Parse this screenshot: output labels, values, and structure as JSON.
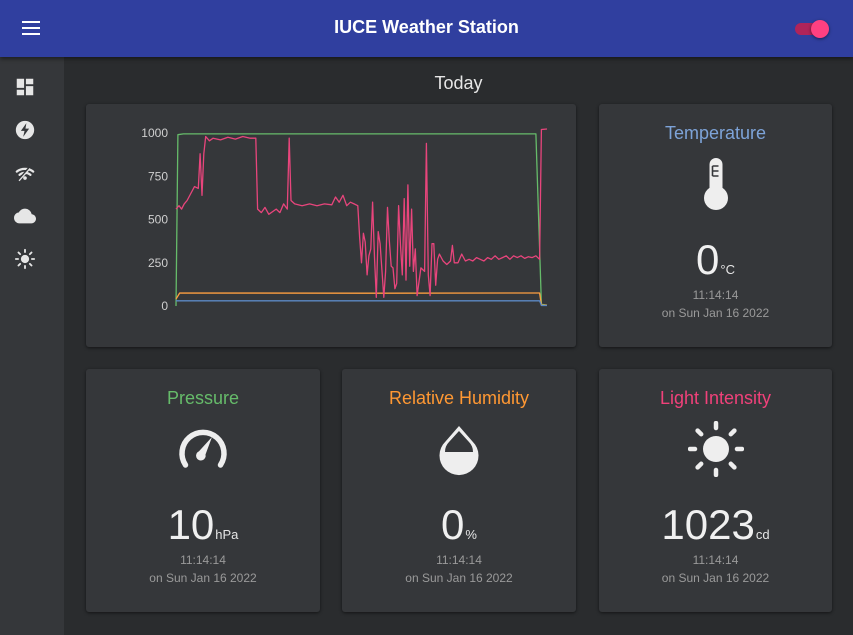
{
  "app": {
    "title": "IUCE Weather Station",
    "accent_color": "#303f9f",
    "toggle_on": true,
    "toggle_color": "#ff4081"
  },
  "sidebar": {
    "items": [
      {
        "icon": "dashboard-icon"
      },
      {
        "icon": "bolt-icon"
      },
      {
        "icon": "wifi-icon"
      },
      {
        "icon": "cloud-icon"
      },
      {
        "icon": "sun-icon"
      }
    ]
  },
  "page": {
    "title": "Today"
  },
  "chart_data": {
    "type": "line",
    "title": "",
    "xlabel": "",
    "ylabel": "",
    "ylim": [
      0,
      1000
    ],
    "yticks": [
      "1000",
      "750",
      "500",
      "250",
      "0"
    ],
    "grid": false,
    "legend": "none",
    "series": [
      {
        "color": "#66bb6a",
        "values": [
          [
            0,
            0
          ],
          [
            0.5,
            990
          ],
          [
            2,
            995
          ],
          [
            50,
            995
          ],
          [
            97,
            995
          ],
          [
            98.5,
            10
          ],
          [
            100,
            5
          ]
        ]
      },
      {
        "color": "#ff9f40",
        "values": [
          [
            0,
            40
          ],
          [
            1,
            75
          ],
          [
            50,
            74
          ],
          [
            98,
            75
          ],
          [
            98.5,
            5
          ],
          [
            100,
            5
          ]
        ]
      },
      {
        "color": "#5c88c4",
        "values": [
          [
            0,
            30
          ],
          [
            98,
            30
          ],
          [
            98.5,
            3
          ],
          [
            100,
            3
          ]
        ]
      },
      {
        "color": "#e8457c",
        "values": [
          [
            0,
            560
          ],
          [
            0.8,
            580
          ],
          [
            1.5,
            560
          ],
          [
            2.2,
            590
          ],
          [
            3,
            610
          ],
          [
            4,
            650
          ],
          [
            5,
            690
          ],
          [
            6,
            680
          ],
          [
            6.5,
            880
          ],
          [
            7,
            640
          ],
          [
            7.5,
            880
          ],
          [
            8,
            980
          ],
          [
            9,
            955
          ],
          [
            10,
            970
          ],
          [
            12,
            960
          ],
          [
            14,
            975
          ],
          [
            16,
            965
          ],
          [
            18,
            980
          ],
          [
            20,
            970
          ],
          [
            21.5,
            970
          ],
          [
            22,
            560
          ],
          [
            23,
            540
          ],
          [
            24,
            570
          ],
          [
            25,
            530
          ],
          [
            27,
            560
          ],
          [
            28,
            540
          ],
          [
            29,
            590
          ],
          [
            30,
            560
          ],
          [
            30.5,
            970
          ],
          [
            31,
            610
          ],
          [
            32,
            590
          ],
          [
            34,
            580
          ],
          [
            36,
            590
          ],
          [
            38,
            580
          ],
          [
            40,
            590
          ],
          [
            42,
            585
          ],
          [
            43,
            630
          ],
          [
            44,
            600
          ],
          [
            45,
            640
          ],
          [
            46,
            580
          ],
          [
            47,
            600
          ],
          [
            48,
            590
          ],
          [
            49,
            580
          ],
          [
            49.5,
            400
          ],
          [
            50,
            250
          ],
          [
            50.5,
            420
          ],
          [
            51,
            370
          ],
          [
            51.5,
            180
          ],
          [
            52,
            290
          ],
          [
            52.5,
            330
          ],
          [
            53,
            600
          ],
          [
            53.5,
            280
          ],
          [
            54,
            50
          ],
          [
            54.5,
            430
          ],
          [
            55,
            360
          ],
          [
            56,
            50
          ],
          [
            56.5,
            200
          ],
          [
            57,
            570
          ],
          [
            57.5,
            380
          ],
          [
            58,
            230
          ],
          [
            58.5,
            220
          ],
          [
            59,
            100
          ],
          [
            59.5,
            130
          ],
          [
            60,
            580
          ],
          [
            60.5,
            350
          ],
          [
            61,
            180
          ],
          [
            61.5,
            620
          ],
          [
            62,
            150
          ],
          [
            62.5,
            700
          ],
          [
            63,
            230
          ],
          [
            63.5,
            560
          ],
          [
            64,
            200
          ],
          [
            64.5,
            330
          ],
          [
            65,
            60
          ],
          [
            66,
            220
          ],
          [
            67,
            200
          ],
          [
            67.5,
            940
          ],
          [
            68,
            180
          ],
          [
            68.5,
            60
          ],
          [
            69,
            360
          ],
          [
            69.5,
            360
          ],
          [
            70,
            120
          ],
          [
            70.5,
            270
          ],
          [
            71,
            300
          ],
          [
            72,
            260
          ],
          [
            73,
            240
          ],
          [
            74,
            260
          ],
          [
            74.5,
            350
          ],
          [
            75,
            250
          ],
          [
            76,
            250
          ],
          [
            77,
            300
          ],
          [
            78,
            260
          ],
          [
            79,
            270
          ],
          [
            80,
            260
          ],
          [
            81,
            280
          ],
          [
            82,
            270
          ],
          [
            83,
            260
          ],
          [
            84,
            280
          ],
          [
            85,
            270
          ],
          [
            86,
            290
          ],
          [
            87,
            270
          ],
          [
            88,
            280
          ],
          [
            89,
            290
          ],
          [
            90,
            270
          ],
          [
            91,
            290
          ],
          [
            92,
            280
          ],
          [
            93,
            290
          ],
          [
            94,
            275
          ],
          [
            95,
            285
          ],
          [
            96,
            280
          ],
          [
            97,
            290
          ],
          [
            98,
            270
          ],
          [
            98.5,
            1020
          ],
          [
            100,
            1023
          ]
        ]
      }
    ]
  },
  "sensors": {
    "temperature": {
      "title": "Temperature",
      "value": "0",
      "unit": "°C",
      "time": "11:14:14",
      "date": "on Sun Jan 16 2022",
      "color": "#7da3d8",
      "icon": "thermometer-icon"
    },
    "pressure": {
      "title": "Pressure",
      "value": "10",
      "unit": "hPa",
      "time": "11:14:14",
      "date": "on Sun Jan 16 2022",
      "color": "#66bb6a",
      "icon": "gauge-icon"
    },
    "humidity": {
      "title": "Relative Humidity",
      "value": "0",
      "unit": "%",
      "time": "11:14:14",
      "date": "on Sun Jan 16 2022",
      "color": "#ff9833",
      "icon": "water-drop-icon"
    },
    "light": {
      "title": "Light Intensity",
      "value": "1023",
      "unit": "cd",
      "time": "11:14:14",
      "date": "on Sun Jan 16 2022",
      "color": "#f0417a",
      "icon": "sun-icon"
    }
  }
}
